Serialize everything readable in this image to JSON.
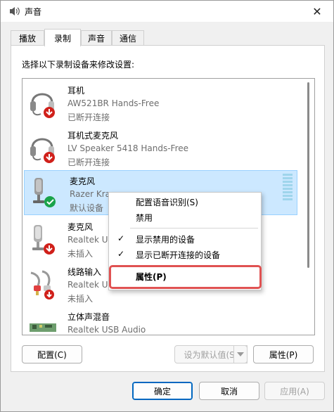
{
  "window": {
    "title": "声音",
    "close_glyph": "✕"
  },
  "tabs": [
    {
      "label": "播放",
      "active": false
    },
    {
      "label": "录制",
      "active": true
    },
    {
      "label": "声音",
      "active": false
    },
    {
      "label": "通信",
      "active": false
    }
  ],
  "instruction": "选择以下录制设备来修改设置:",
  "devices": [
    {
      "name": "耳机",
      "desc": "AW521BR Hands-Free",
      "status": "已断开连接",
      "icon": "headset-icon",
      "badge": "disconnected-arrow-icon"
    },
    {
      "name": "耳机式麦克风",
      "desc": "LV Speaker 5418 Hands-Free",
      "status": "已断开连接",
      "icon": "headset-icon",
      "badge": "disconnected-arrow-icon"
    },
    {
      "name": "麦克风",
      "desc": "Razer Kra",
      "status": "默认设备",
      "icon": "microphone-icon",
      "badge": "default-check-icon"
    },
    {
      "name": "麦克风",
      "desc": "Realtek US",
      "status": "未插入",
      "icon": "microphone-icon",
      "badge": "disconnected-arrow-icon"
    },
    {
      "name": "线路输入",
      "desc": "Realtek US",
      "status": "未插入",
      "icon": "line-in-cable-icon",
      "badge": "disconnected-arrow-icon"
    },
    {
      "name": "立体声混音",
      "desc": "Realtek USB Audio",
      "status": "",
      "icon": "sound-card-icon",
      "badge": ""
    }
  ],
  "context_menu": {
    "items": [
      {
        "label": "配置语音识别(S)",
        "checked": false
      },
      {
        "label": "禁用",
        "checked": false
      },
      {
        "label": "显示禁用的设备",
        "checked": true
      },
      {
        "label": "显示已断开连接的设备",
        "checked": true
      },
      {
        "label": "属性(P)",
        "checked": false,
        "bold": true,
        "highlighted": true
      }
    ],
    "check_glyph": "✓"
  },
  "panel_buttons": {
    "configure": "配置(C)",
    "set_default": "设为默认值(S)",
    "properties": "属性(P)"
  },
  "dialog_buttons": {
    "ok": "确定",
    "cancel": "取消",
    "apply": "应用(A)"
  },
  "colors": {
    "selection": "#cce8ff",
    "accent": "#0067c0",
    "highlight_outline": "#e05252",
    "default_badge": "#1aa34a",
    "disconnect_badge": "#d0201a"
  }
}
